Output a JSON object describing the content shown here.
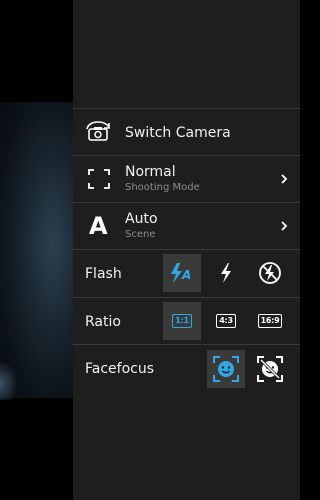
{
  "menu": {
    "switch_camera": {
      "label": "Switch Camera",
      "icon": "switch-camera-icon"
    },
    "shooting_mode": {
      "label": "Normal",
      "sub": "Shooting Mode",
      "icon": "frame-corners-icon"
    },
    "scene": {
      "label": "Auto",
      "sub": "Scene",
      "icon_glyph": "A"
    },
    "flash": {
      "label": "Flash",
      "options": [
        "flash-auto-icon",
        "flash-on-icon",
        "flash-off-icon"
      ],
      "option_glyphs": {
        "flash_auto_letter": "A"
      },
      "selected": "flash-auto-icon"
    },
    "ratio": {
      "label": "Ratio",
      "options": [
        "1:1",
        "4:3",
        "16:9"
      ],
      "selected": "1:1"
    },
    "facefocus": {
      "label": "Facefocus",
      "options": [
        "facefocus-on-icon",
        "facefocus-off-icon"
      ],
      "selected": "facefocus-on-icon"
    }
  },
  "colors": {
    "accent": "#2fa9e6",
    "panel": "#1e1e1e",
    "selected_bg": "#3a3a3a",
    "divider": "#393939"
  }
}
